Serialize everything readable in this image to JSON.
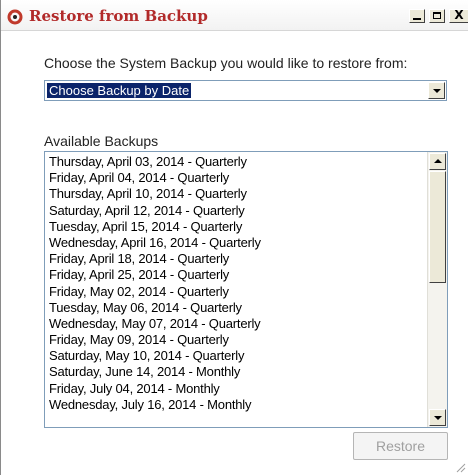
{
  "window": {
    "title": "Restore from Backup",
    "title_color": "#b22a2a"
  },
  "controls": {
    "minimize_icon": "minimize-icon",
    "maximize_icon": "maximize-icon",
    "close_label": "X"
  },
  "choose": {
    "label": "Choose the System Backup you would like to restore from:",
    "selected_value": "Choose Backup by Date",
    "selection_color": "#0b246a"
  },
  "backups": {
    "label": "Available Backups",
    "items": [
      "Thursday, April 03, 2014 - Quarterly",
      "Friday, April 04, 2014 - Quarterly",
      "Thursday, April 10, 2014 - Quarterly",
      "Saturday, April 12, 2014 - Quarterly",
      "Tuesday, April 15, 2014 - Quarterly",
      "Wednesday, April 16, 2014 - Quarterly",
      "Friday, April 18, 2014 - Quarterly",
      "Friday, April 25, 2014 - Quarterly",
      "Friday, May 02, 2014 - Quarterly",
      "Tuesday, May 06, 2014 - Quarterly",
      "Wednesday, May 07, 2014 - Quarterly",
      "Friday, May 09, 2014 - Quarterly",
      "Saturday, May 10, 2014 - Quarterly",
      "Saturday, June 14, 2014 - Monthly",
      "Friday, July 04, 2014 - Monthly",
      "Wednesday, July 16, 2014 - Monthly"
    ]
  },
  "actions": {
    "restore_label": "Restore",
    "restore_enabled": false
  }
}
